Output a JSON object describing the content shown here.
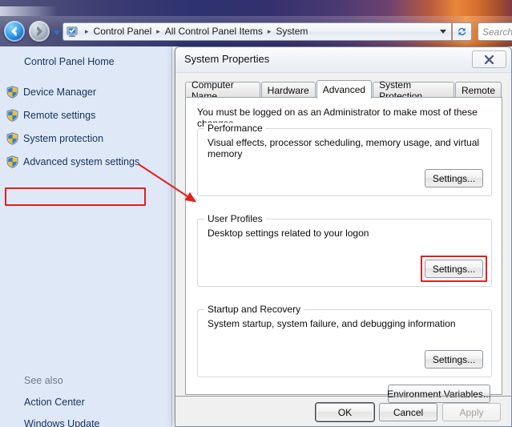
{
  "explorer": {
    "back_tooltip": "Back",
    "forward_tooltip": "Forward",
    "recent_pages_tooltip": "Recent pages",
    "breadcrumbs": [
      "Control Panel",
      "All Control Panel Items",
      "System"
    ],
    "breadcrumb_separator": "▸",
    "address_icon": "computer-icon",
    "refresh_icon": "refresh-icon",
    "search_placeholder": "Search"
  },
  "sidebar": {
    "home_label": "Control Panel Home",
    "items": [
      {
        "label": "Device Manager",
        "icon": "uac-shield-icon",
        "highlighted": false
      },
      {
        "label": "Remote settings",
        "icon": "uac-shield-icon",
        "highlighted": false
      },
      {
        "label": "System protection",
        "icon": "uac-shield-icon",
        "highlighted": false
      },
      {
        "label": "Advanced system settings",
        "icon": "uac-shield-icon",
        "highlighted": true
      }
    ],
    "see_also_label": "See also",
    "see_also_links": [
      "Action Center",
      "Windows Update"
    ]
  },
  "dialog": {
    "title": "System Properties",
    "close_label": "✖",
    "close_icon": "close-icon",
    "tabs": [
      {
        "label": "Computer Name",
        "active": false
      },
      {
        "label": "Hardware",
        "active": false
      },
      {
        "label": "Advanced",
        "active": true
      },
      {
        "label": "System Protection",
        "active": false
      },
      {
        "label": "Remote",
        "active": false
      }
    ],
    "admin_note": "You must be logged on as an Administrator to make most of these changes.",
    "groups": [
      {
        "title": "Performance",
        "description": "Visual effects, processor scheduling, memory usage, and virtual memory",
        "button_label": "Settings...",
        "button_highlighted": false
      },
      {
        "title": "User Profiles",
        "description": "Desktop settings related to your logon",
        "button_label": "Settings...",
        "button_highlighted": true
      },
      {
        "title": "Startup and Recovery",
        "description": "System startup, system failure, and debugging information",
        "button_label": "Settings...",
        "button_highlighted": false
      }
    ],
    "environment_variables_label": "Environment Variables...",
    "footer": {
      "ok_label": "OK",
      "cancel_label": "Cancel",
      "apply_label": "Apply",
      "apply_disabled": true
    }
  },
  "annotation": {
    "color": "#e32020",
    "arrow_name": "red-pointer-arrow",
    "description": "Arrow from Advanced system settings to User Profiles"
  }
}
